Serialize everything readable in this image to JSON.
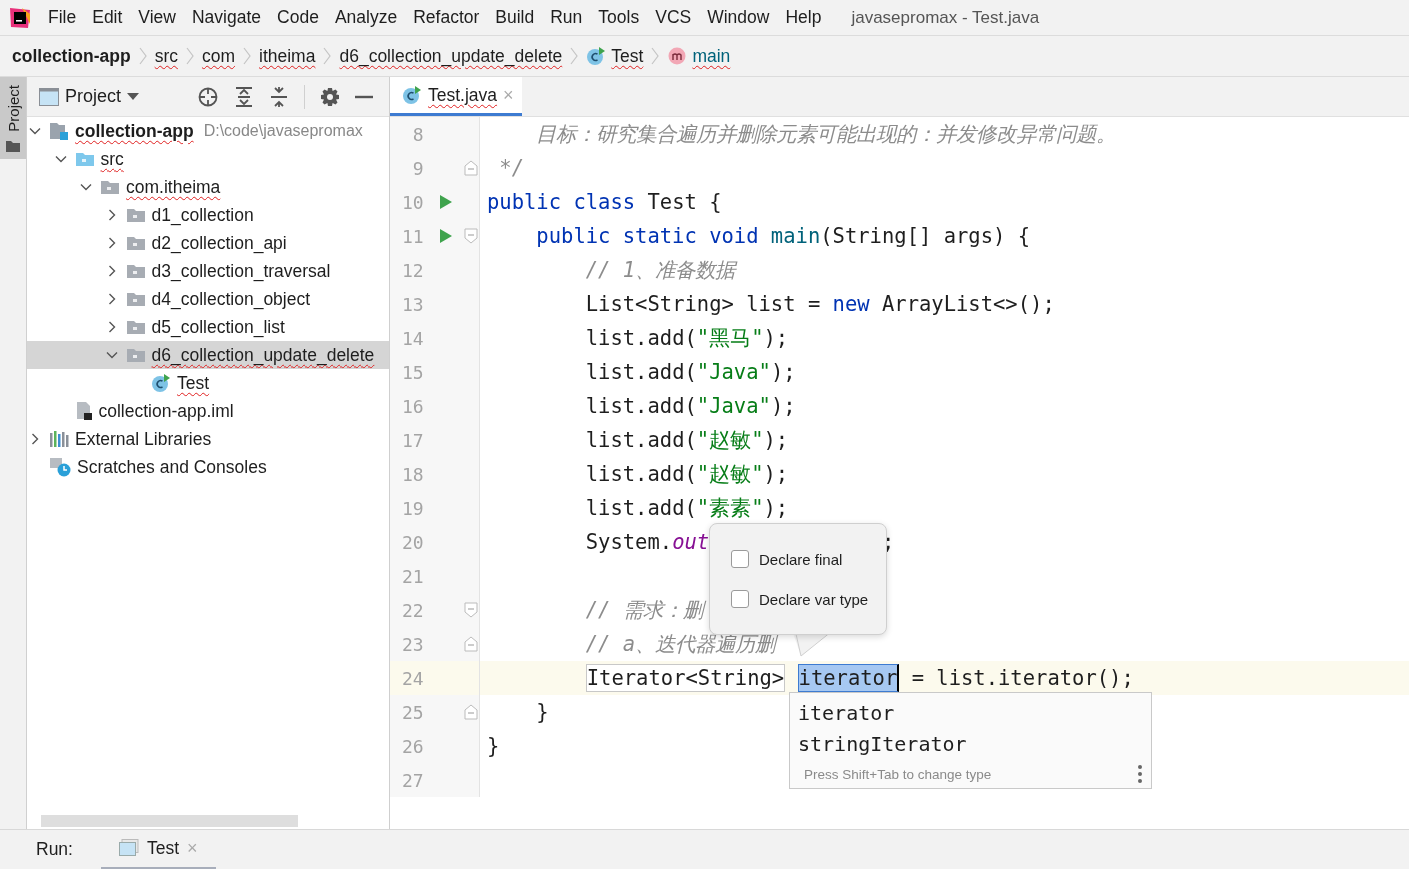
{
  "menu_bar": {
    "items": [
      "File",
      "Edit",
      "View",
      "Navigate",
      "Code",
      "Analyze",
      "Refactor",
      "Build",
      "Run",
      "Tools",
      "VCS",
      "Window",
      "Help"
    ],
    "title": "javasepromax - Test.java"
  },
  "breadcrumbs": [
    {
      "label": "collection-app",
      "kind": "module",
      "misspelled": false
    },
    {
      "label": "src",
      "kind": "folder",
      "misspelled": true
    },
    {
      "label": "com",
      "kind": "folder",
      "misspelled": true
    },
    {
      "label": "itheima",
      "kind": "folder",
      "misspelled": true
    },
    {
      "label": "d6_collection_update_delete",
      "kind": "folder",
      "misspelled": true
    },
    {
      "label": "Test",
      "kind": "class",
      "misspelled": true
    },
    {
      "label": "main",
      "kind": "method",
      "misspelled": true
    }
  ],
  "tool_strip": {
    "tabs": [
      {
        "label": "Project",
        "selected": true
      }
    ]
  },
  "project_panel": {
    "title": "Project",
    "tree": [
      {
        "label": "collection-app",
        "kind": "module",
        "hint": "D:\\code\\javasepromax",
        "misspelled": true,
        "selected": false,
        "expanded": true,
        "children": [
          {
            "label": "src",
            "kind": "source_folder",
            "misspelled": true,
            "selected": false,
            "expanded": true,
            "children": [
              {
                "label": "com.itheima",
                "kind": "package",
                "misspelled": true,
                "selected": false,
                "expanded": true,
                "children": [
                  {
                    "label": "d1_collection",
                    "kind": "package",
                    "misspelled": false,
                    "selected": false,
                    "expanded": false
                  },
                  {
                    "label": "d2_collection_api",
                    "kind": "package",
                    "misspelled": false,
                    "selected": false,
                    "expanded": false
                  },
                  {
                    "label": "d3_collection_traversal",
                    "kind": "package",
                    "misspelled": false,
                    "selected": false,
                    "expanded": false
                  },
                  {
                    "label": "d4_collection_object",
                    "kind": "package",
                    "misspelled": false,
                    "selected": false,
                    "expanded": false
                  },
                  {
                    "label": "d5_collection_list",
                    "kind": "package",
                    "misspelled": false,
                    "selected": false,
                    "expanded": false
                  },
                  {
                    "label": "d6_collection_update_delete",
                    "kind": "package",
                    "misspelled": true,
                    "selected": true,
                    "expanded": true,
                    "children": [
                      {
                        "label": "Test",
                        "kind": "class",
                        "misspelled": true,
                        "selected": false
                      }
                    ]
                  }
                ]
              }
            ]
          },
          {
            "label": "collection-app.iml",
            "kind": "iml",
            "misspelled": false,
            "selected": false
          }
        ]
      },
      {
        "label": "External Libraries",
        "kind": "libraries",
        "misspelled": false,
        "selected": false,
        "expanded": false
      },
      {
        "label": "Scratches and Consoles",
        "kind": "scratches",
        "misspelled": false,
        "selected": false
      }
    ]
  },
  "editor": {
    "tabs": [
      {
        "label": "Test.java",
        "close": "×",
        "misspelled": true,
        "selected": true
      }
    ],
    "lines": [
      {
        "number": "8",
        "run": false,
        "fold_start": false,
        "fold_end": false,
        "current": false,
        "tokens": [
          {
            "kind": "comment",
            "text": "    目标：研究集合遍历并删除元素可能出现的：并发修改异常问题。"
          }
        ]
      },
      {
        "number": "9",
        "run": false,
        "fold_start": false,
        "fold_end": true,
        "current": false,
        "tokens": [
          {
            "kind": "comment",
            "text": " */"
          }
        ]
      },
      {
        "number": "10",
        "run": true,
        "fold_start": false,
        "fold_end": false,
        "current": false,
        "tokens": [
          {
            "kind": "keyword",
            "text": "public class "
          },
          {
            "kind": "plain",
            "text": "Test {"
          }
        ],
        "children": [
          {
            "number": "11",
            "run": true,
            "fold_start": true,
            "fold_end": false,
            "current": false,
            "tokens": [
              {
                "kind": "keyword",
                "text": "public static void "
              },
              {
                "kind": "method",
                "text": "main"
              },
              {
                "kind": "plain",
                "text": "(String[] args) {"
              }
            ],
            "children": [
              {
                "number": "12",
                "run": false,
                "fold_start": false,
                "fold_end": false,
                "current": false,
                "tokens": [
                  {
                    "kind": "comment",
                    "text": "// 1、准备数据"
                  }
                ]
              },
              {
                "number": "13",
                "run": false,
                "fold_start": false,
                "fold_end": false,
                "current": false,
                "tokens": [
                  {
                    "kind": "plain",
                    "text": "List<String> list = "
                  },
                  {
                    "kind": "keyword",
                    "text": "new "
                  },
                  {
                    "kind": "plain",
                    "text": "ArrayList<>();"
                  }
                ]
              },
              {
                "number": "14",
                "run": false,
                "fold_start": false,
                "fold_end": false,
                "current": false,
                "tokens": [
                  {
                    "kind": "plain",
                    "text": "list.add("
                  },
                  {
                    "kind": "string",
                    "text": "\"黑马\""
                  },
                  {
                    "kind": "plain",
                    "text": ");"
                  }
                ]
              },
              {
                "number": "15",
                "run": false,
                "fold_start": false,
                "fold_end": false,
                "current": false,
                "tokens": [
                  {
                    "kind": "plain",
                    "text": "list.add("
                  },
                  {
                    "kind": "string",
                    "text": "\"Java\""
                  },
                  {
                    "kind": "plain",
                    "text": ");"
                  }
                ]
              },
              {
                "number": "16",
                "run": false,
                "fold_start": false,
                "fold_end": false,
                "current": false,
                "tokens": [
                  {
                    "kind": "plain",
                    "text": "list.add("
                  },
                  {
                    "kind": "string",
                    "text": "\"Java\""
                  },
                  {
                    "kind": "plain",
                    "text": ");"
                  }
                ]
              },
              {
                "number": "17",
                "run": false,
                "fold_start": false,
                "fold_end": false,
                "current": false,
                "tokens": [
                  {
                    "kind": "plain",
                    "text": "list.add("
                  },
                  {
                    "kind": "string",
                    "text": "\"赵敏\""
                  },
                  {
                    "kind": "plain",
                    "text": ");"
                  }
                ]
              },
              {
                "number": "18",
                "run": false,
                "fold_start": false,
                "fold_end": false,
                "current": false,
                "tokens": [
                  {
                    "kind": "plain",
                    "text": "list.add("
                  },
                  {
                    "kind": "string",
                    "text": "\"赵敏\""
                  },
                  {
                    "kind": "plain",
                    "text": ");"
                  }
                ]
              },
              {
                "number": "19",
                "run": false,
                "fold_start": false,
                "fold_end": false,
                "current": false,
                "tokens": [
                  {
                    "kind": "plain",
                    "text": "list.add("
                  },
                  {
                    "kind": "string",
                    "text": "\"素素\""
                  },
                  {
                    "kind": "plain",
                    "text": ");"
                  }
                ]
              },
              {
                "number": "20",
                "run": false,
                "fold_start": false,
                "fold_end": false,
                "current": false,
                "tokens": [
                  {
                    "kind": "plain",
                    "text": "System."
                  },
                  {
                    "kind": "static_field",
                    "text": "out"
                  },
                  {
                    "kind": "plain",
                    "text": "              ;"
                  }
                ]
              },
              {
                "number": "21",
                "run": false,
                "fold_start": false,
                "fold_end": false,
                "current": false
              },
              {
                "number": "22",
                "run": false,
                "fold_start": true,
                "fold_end": false,
                "current": false,
                "tokens": [
                  {
                    "kind": "comment",
                    "text": "// 需求：删"
                  }
                ]
              },
              {
                "number": "23",
                "run": false,
                "fold_start": false,
                "fold_end": true,
                "current": false,
                "tokens": [
                  {
                    "kind": "comment",
                    "text": "// a、迭代器遍历删"
                  }
                ]
              },
              {
                "number": "24",
                "run": false,
                "fold_start": false,
                "fold_end": false,
                "current": true,
                "tokens": [
                  {
                    "kind": "template",
                    "text": "Iterator<String>"
                  },
                  {
                    "kind": "template_active",
                    "text": "iterator"
                  },
                  {
                    "kind": "plain",
                    "text": "= list.iterator();"
                  }
                ]
              }
            ]
          },
          {
            "number": "25",
            "run": false,
            "fold_start": false,
            "fold_end": true,
            "current": false,
            "tokens": [
              {
                "kind": "plain",
                "text": "}"
              }
            ]
          }
        ]
      },
      {
        "number": "26",
        "run": false,
        "fold_start": false,
        "fold_end": false,
        "current": false,
        "tokens": [
          {
            "kind": "plain",
            "text": "}"
          }
        ]
      },
      {
        "number": "27",
        "run": false,
        "fold_start": false,
        "fold_end": false,
        "current": false
      }
    ],
    "options_popup": {
      "options": [
        {
          "label": "Declare final",
          "checked": false
        },
        {
          "label": "Declare var type",
          "checked": false
        }
      ]
    },
    "completion": {
      "items": [
        "iterator",
        "stringIterator"
      ],
      "hint": "Press Shift+Tab to change type"
    }
  },
  "run_bar": {
    "label": "Run:",
    "tabs": [
      {
        "label": "Test",
        "close": "×",
        "selected": true
      }
    ]
  }
}
